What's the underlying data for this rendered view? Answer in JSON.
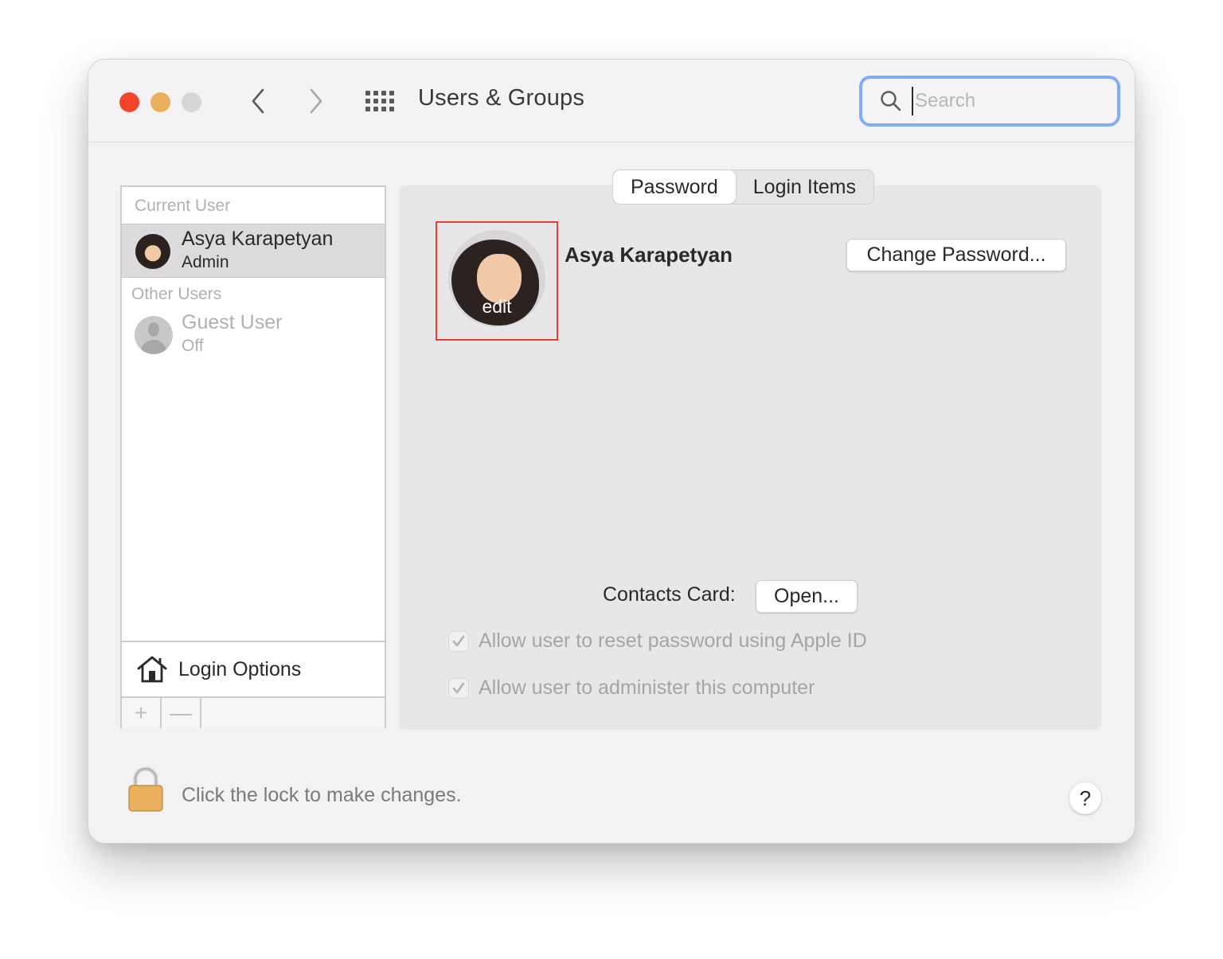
{
  "window": {
    "title": "Users & Groups",
    "traffic_lights": {
      "close_color": "#f2452b",
      "minimize_color": "#e9b15d",
      "zoom_color": "#d7d5d7"
    },
    "nav": {
      "back_icon": "chevron-left-icon",
      "forward_icon": "chevron-right-icon",
      "grid_icon": "grid-icon"
    },
    "search": {
      "placeholder": "Search",
      "value": "",
      "focus_color": "#80aef3"
    }
  },
  "sidebar": {
    "current_user_label": "Current User",
    "current_user": {
      "name": "Asya Karapetyan",
      "role": "Admin",
      "selected": true
    },
    "other_users_label": "Other Users",
    "other_users": [
      {
        "name": "Guest User",
        "status": "Off"
      }
    ],
    "login_options_label": "Login Options",
    "add_symbol": "+",
    "remove_symbol": "—"
  },
  "main": {
    "tabs": [
      {
        "label": "Password",
        "active": true
      },
      {
        "label": "Login Items",
        "active": false
      }
    ],
    "avatar_edit_label": "edit",
    "highlight_color": "#e8402f",
    "profile_name": "Asya Karapetyan",
    "change_password_label": "Change Password...",
    "contacts_card_label": "Contacts Card:",
    "open_label": "Open...",
    "checkboxes": [
      {
        "label": "Allow user to reset password using Apple ID",
        "checked": true,
        "disabled": true
      },
      {
        "label": "Allow user to administer this computer",
        "checked": true,
        "disabled": true
      }
    ]
  },
  "footer": {
    "lock_text": "Click the lock to make changes.",
    "lock_color": "#e9b15d",
    "help_label": "?"
  }
}
